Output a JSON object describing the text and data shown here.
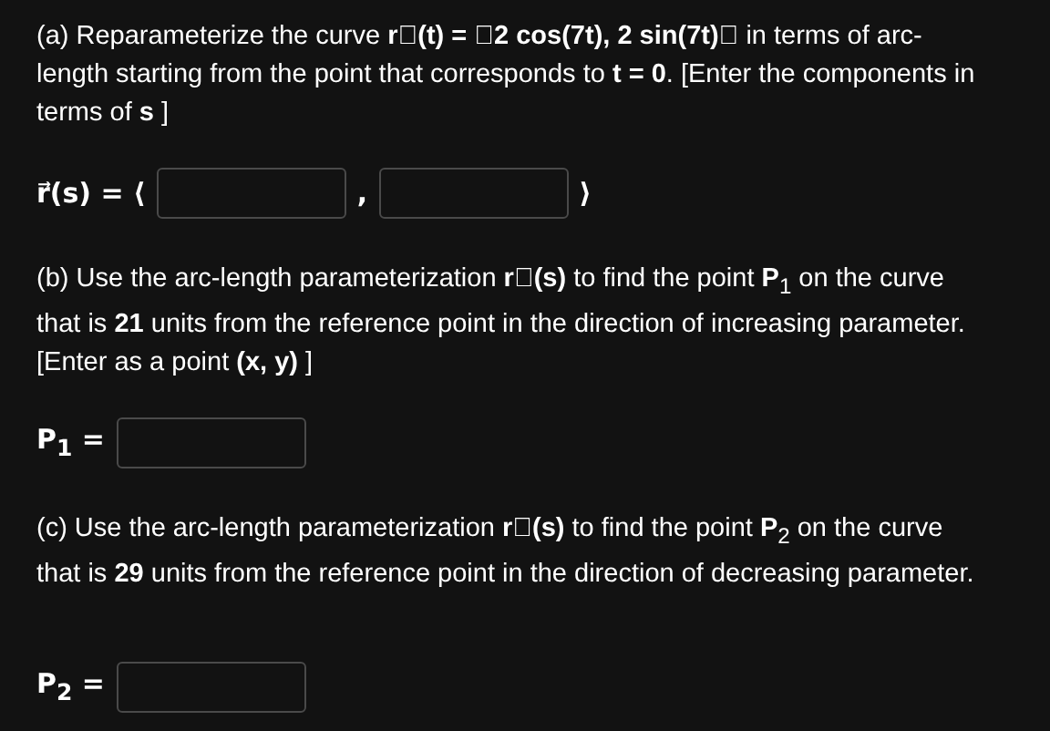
{
  "parts": [
    {
      "text": "(a) Reparameterize the curve **r⃗(t) = ⟨2 cos(7t), 2 sin(7t)⟩** in terms of arc-length starting from the point that corresponds to **t = 0**. [Enter the components in terms of **s** ]",
      "answer": [
        {
          "kind": "text",
          "text": "r⃗(s) = ⟨"
        },
        {
          "kind": "field"
        },
        {
          "kind": "text",
          "text": ","
        },
        {
          "kind": "field"
        },
        {
          "kind": "text",
          "text": "⟩"
        }
      ]
    },
    {
      "text": "(b) Use the arc-length parameterization **r⃗(s)** to find the point **P**$_{1}$ on the curve that is **21** units from the reference point in the direction of increasing parameter. [Enter as a point **(x, y)** ]",
      "answer": [
        {
          "kind": "text",
          "text": "P$_{1}$ ="
        },
        {
          "kind": "field"
        }
      ]
    },
    {
      "text": "(c) Use the arc-length parameterization **r⃗(s)** to find the point **P**$_{2}$ on the curve that is **29** units from the reference point in the direction of decreasing parameter.",
      "answer": [
        {
          "kind": "text",
          "text": "P$_{2}$ ="
        },
        {
          "kind": "field"
        }
      ]
    }
  ]
}
